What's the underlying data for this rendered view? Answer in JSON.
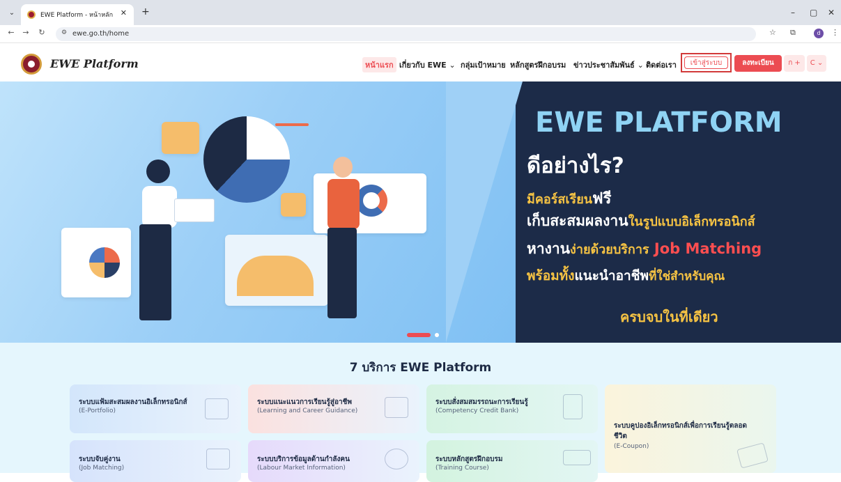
{
  "browser": {
    "tab_title": "EWE Platform - หน้าหลัก",
    "url": "ewe.go.th/home",
    "profile_initial": "d",
    "icons": [
      "tab-search-icon",
      "favicon-icon",
      "close-icon",
      "new-tab-icon",
      "minimize-icon",
      "restore-icon",
      "close-window-icon",
      "back-icon",
      "forward-icon",
      "reload-icon",
      "site-info-icon",
      "star-icon",
      "extensions-icon",
      "menu-icon"
    ]
  },
  "header": {
    "logo_text": "EWE Platform",
    "nav": [
      {
        "label": "หน้าแรก"
      },
      {
        "label": "เกี่ยวกับ EWE"
      },
      {
        "label": "กลุ่มเป้าหมาย"
      },
      {
        "label": "หลักสูตรฝึกอบรม"
      },
      {
        "label": "ข่าวประชาสัมพันธ์"
      },
      {
        "label": "ติดต่อเรา"
      }
    ],
    "login_label": "เข้าสู่ระบบ",
    "register_label": "ลงทะเบียน",
    "font_size_label": "ก +",
    "color_label": "C"
  },
  "hero": {
    "title": "EWE PLATFORM",
    "subtitle": "ดีอย่างไร?",
    "line1_a": "มีคอร์สเรียน",
    "line1_b": "ฟรี",
    "line2_a": "เก็บสะสมผลงาน",
    "line2_b": "ในรูปแบบอิเล็กทรอนิกส์",
    "line3_a": "หางาน",
    "line3_b": "ง่ายด้วยบริการ",
    "line3_c": "Job Matching",
    "line4_a": "พร้อมทั้ง",
    "line4_b": "แนะนำอาชีพ",
    "line4_c": "ที่ใช่สำหรับคุณ",
    "final": "ครบจบในที่เดียว"
  },
  "services": {
    "title": "7 บริการ EWE Platform",
    "cards": [
      {
        "name": "ระบบแฟ้มสะสมผลงานอิเล็กทรอนิกส์",
        "sub": "(E-Portfolio)"
      },
      {
        "name": "ระบบแนะแนวการเรียนรู้สู่อาชีพ",
        "sub": "(Learning and Career Guidance)"
      },
      {
        "name": "ระบบสั่งสมสมรรถนะการเรียนรู้",
        "sub": "(Competency Credit Bank)"
      },
      {
        "name": "ระบบคูปองอิเล็กทรอนิกส์เพื่อการเรียนรู้ตลอด",
        "name2": "ชีวิต",
        "sub": "(E-Coupon)"
      },
      {
        "name": "ระบบจับคู่งาน",
        "sub": "(Job Matching)"
      },
      {
        "name": "ระบบบริการข้อมูลด้านกำลังคน",
        "sub": "(Labour Market Information)"
      },
      {
        "name": "ระบบหลักสูตรฝึกอบรม",
        "sub": "(Training Course)"
      }
    ]
  },
  "colors": {
    "accent": "#ec4c52",
    "navy": "#1c2b48",
    "title_blue": "#8fd3f4",
    "yellow": "#f6c343"
  }
}
